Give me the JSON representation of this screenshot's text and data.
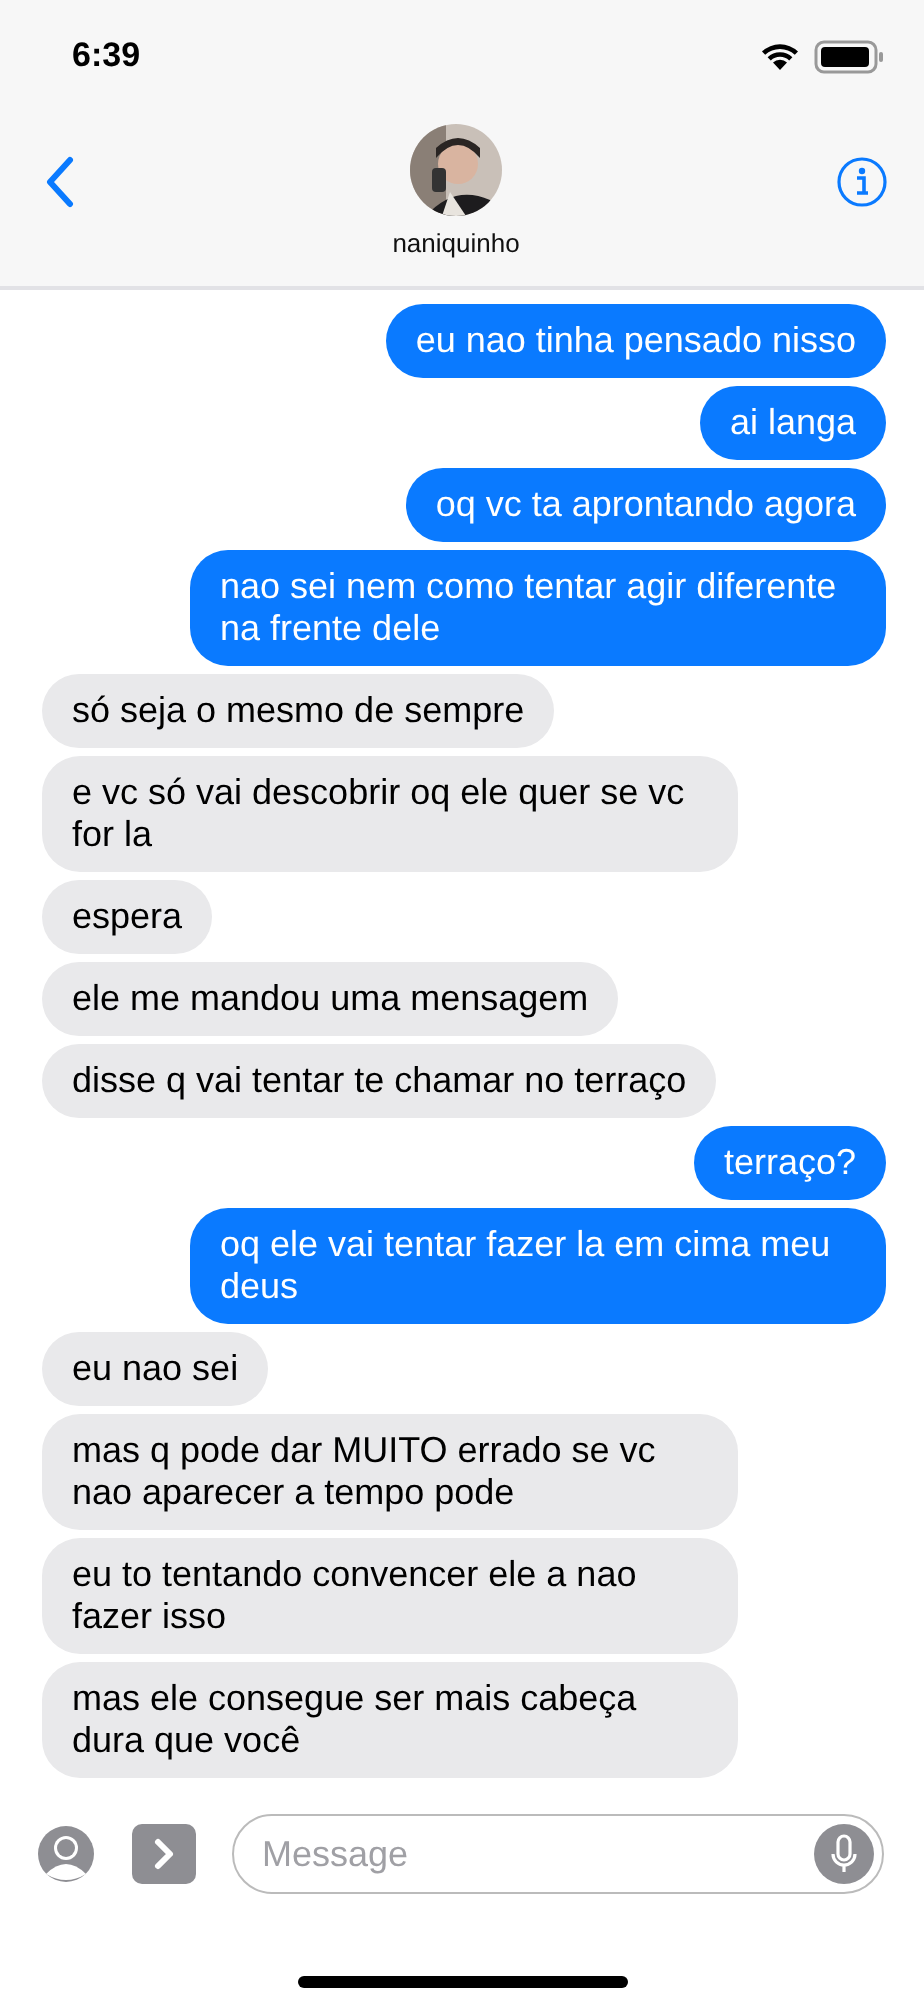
{
  "status_bar": {
    "time": "6:39"
  },
  "header": {
    "contact_name": "naniquinho"
  },
  "messages": [
    {
      "kind": "outgoing",
      "text": "eu nao tinha pensado nisso"
    },
    {
      "kind": "outgoing",
      "text": "ai langa"
    },
    {
      "kind": "outgoing",
      "text": "oq vc ta aprontando agora"
    },
    {
      "kind": "outgoing",
      "text": "nao sei nem como tentar agir diferente na frente dele"
    },
    {
      "kind": "incoming",
      "text": "só seja o mesmo de sempre"
    },
    {
      "kind": "incoming",
      "text": "e vc só vai descobrir oq ele quer se vc for la"
    },
    {
      "kind": "incoming",
      "text": "espera"
    },
    {
      "kind": "incoming",
      "text": "ele me mandou uma mensagem"
    },
    {
      "kind": "incoming",
      "text": "disse q vai tentar te chamar no terraço"
    },
    {
      "kind": "outgoing",
      "text": "terraço?"
    },
    {
      "kind": "outgoing",
      "text": "oq ele vai tentar fazer la em cima meu deus"
    },
    {
      "kind": "incoming",
      "text": "eu nao sei"
    },
    {
      "kind": "incoming",
      "text": "mas q pode dar MUITO errado se vc nao aparecer a tempo pode"
    },
    {
      "kind": "incoming",
      "text": "eu to tentando convencer ele a nao fazer isso"
    },
    {
      "kind": "incoming",
      "text": "mas ele consegue ser mais cabeça dura que você"
    }
  ],
  "composer": {
    "placeholder": "Message"
  }
}
